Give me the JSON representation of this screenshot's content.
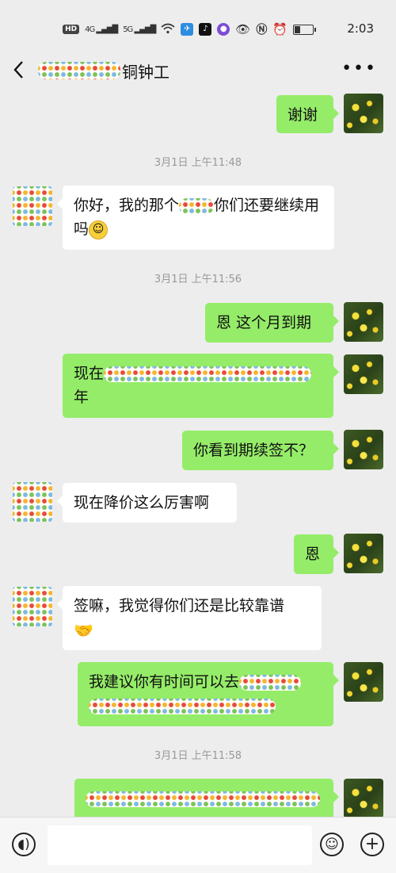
{
  "status_bar": {
    "badges": [
      "HD",
      "4G",
      "5G"
    ],
    "time": "2:03"
  },
  "header": {
    "title": "铜钟工"
  },
  "colors": {
    "outgoing_bubble": "#95ec69",
    "incoming_bubble": "#ffffff",
    "background": "#ededed"
  },
  "messages": [
    {
      "id": "m1",
      "type": "out",
      "text": "谢谢"
    },
    {
      "id": "t1",
      "type": "time",
      "text": "3月1日 上午11:48"
    },
    {
      "id": "m2",
      "type": "in",
      "parts": [
        "你好，我的那个",
        "你们还要继续用吗"
      ]
    },
    {
      "id": "t2",
      "type": "time",
      "text": "3月1日 上午11:56"
    },
    {
      "id": "m3",
      "type": "out",
      "text": "恩 这个月到期"
    },
    {
      "id": "m4",
      "type": "out",
      "parts": [
        "现在",
        "年"
      ]
    },
    {
      "id": "m5",
      "type": "out",
      "text": "你看到期续签不？"
    },
    {
      "id": "m6",
      "type": "in",
      "text": "现在降价这么厉害啊"
    },
    {
      "id": "m7",
      "type": "out",
      "text": "恩"
    },
    {
      "id": "m8",
      "type": "in",
      "text": "签嘛，我觉得你们还是比较靠谱"
    },
    {
      "id": "m9",
      "type": "out",
      "text": "我建议你有时间可以去"
    },
    {
      "id": "t3",
      "type": "time",
      "text": "3月1日 上午11:58"
    }
  ],
  "icons": [
    "back-icon",
    "more-icon",
    "voice-icon",
    "emoji-icon",
    "plus-icon"
  ]
}
